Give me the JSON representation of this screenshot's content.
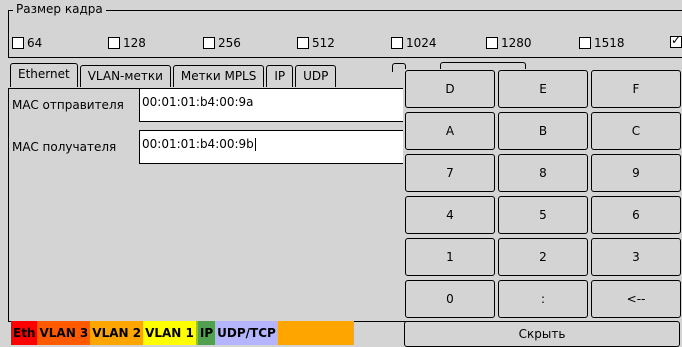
{
  "frame_size": {
    "legend": "Размер кадра",
    "options": [
      {
        "label": "64",
        "checked": false
      },
      {
        "label": "128",
        "checked": false
      },
      {
        "label": "256",
        "checked": false
      },
      {
        "label": "512",
        "checked": false
      },
      {
        "label": "1024",
        "checked": false
      },
      {
        "label": "1280",
        "checked": false
      },
      {
        "label": "1518",
        "checked": false
      },
      {
        "label": "",
        "checked": true
      }
    ]
  },
  "tabs": [
    {
      "label": "Ethernet",
      "active": true
    },
    {
      "label": "VLAN-метки",
      "active": false
    },
    {
      "label": "Метки MPLS",
      "active": false
    },
    {
      "label": "IP",
      "active": false
    },
    {
      "label": "UDP",
      "active": false
    }
  ],
  "ethernet": {
    "src_mac_label": "MAC отправителя",
    "src_mac_value": "00:01:01:b4:00:9a",
    "dst_mac_label": "MAC получателя",
    "dst_mac_value": "00:01:01:b4:00:9b"
  },
  "keypad": {
    "keys": [
      "D",
      "E",
      "F",
      "A",
      "B",
      "C",
      "7",
      "8",
      "9",
      "4",
      "5",
      "6",
      "1",
      "2",
      "3",
      "0",
      ":",
      "<--"
    ],
    "hide_label": "Скрыть"
  },
  "status_bar": {
    "segments": [
      {
        "label": "Eth",
        "color": "#ff0000"
      },
      {
        "label": "VLAN 3",
        "color": "#ff5a00"
      },
      {
        "label": "VLAN 2",
        "color": "#ffa500"
      },
      {
        "label": "VLAN 1",
        "color": "#ffff00"
      },
      {
        "label": "",
        "color": "#a8c000"
      },
      {
        "label": "IP",
        "color": "#50a050"
      },
      {
        "label": "UDP/TCP",
        "color": "#b4b4ff"
      },
      {
        "label": "",
        "color": "#ffa500"
      }
    ]
  }
}
